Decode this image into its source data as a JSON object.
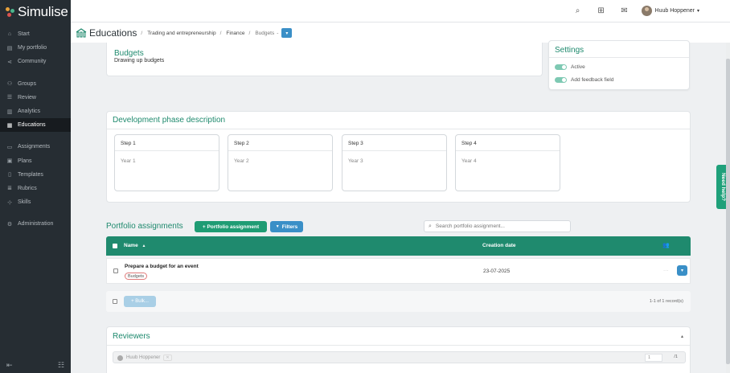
{
  "app": {
    "name": "Simulise"
  },
  "sidebar": {
    "items": [
      {
        "label": "Start",
        "icon": "home-icon",
        "glyph": "⌂"
      },
      {
        "label": "My portfolio",
        "icon": "briefcase-icon",
        "glyph": "▤"
      },
      {
        "label": "Community",
        "icon": "share-icon",
        "glyph": "⋖"
      },
      {
        "label": "Groups",
        "icon": "groups-icon",
        "glyph": "⚇"
      },
      {
        "label": "Review",
        "icon": "list-icon",
        "glyph": "☰"
      },
      {
        "label": "Analytics",
        "icon": "chart-icon",
        "glyph": "▥"
      },
      {
        "label": "Educations",
        "icon": "educations-icon",
        "glyph": "▦"
      },
      {
        "label": "Assignments",
        "icon": "book-icon",
        "glyph": "▭"
      },
      {
        "label": "Plans",
        "icon": "plans-icon",
        "glyph": "▣"
      },
      {
        "label": "Templates",
        "icon": "template-icon",
        "glyph": "▯"
      },
      {
        "label": "Rubrics",
        "icon": "rubrics-icon",
        "glyph": "≣"
      },
      {
        "label": "Skills",
        "icon": "skills-icon",
        "glyph": "⊹"
      },
      {
        "label": "Administration",
        "icon": "admin-icon",
        "glyph": "⚙"
      }
    ],
    "active": "Educations",
    "bottom_left_glyph": "⇤",
    "bottom_right_glyph": "☷"
  },
  "topbar": {
    "search_glyph": "⌕",
    "apps_glyph": "⊞",
    "inbox_glyph": "✉",
    "user_name": "Huub Hoppener",
    "user_caret": "▾"
  },
  "breadcrumb": {
    "title": "Educations",
    "items": [
      "Trading and entrepreneurship",
      "Finance",
      "Budgets"
    ],
    "sep": "/",
    "suffix": "-",
    "dropdown_glyph": "▾"
  },
  "header": {
    "title": "Budgets",
    "subtitle": "Drawing up budgets"
  },
  "settings": {
    "title": "Settings",
    "toggles": [
      {
        "label": "Active",
        "on": true
      },
      {
        "label": "Add feedback field",
        "on": true
      }
    ]
  },
  "development": {
    "title": "Development phase description",
    "steps": [
      {
        "label": "Step 1",
        "text": "Year 1"
      },
      {
        "label": "Step 2",
        "text": "Year 2"
      },
      {
        "label": "Step 3",
        "text": "Year 3"
      },
      {
        "label": "Step 4",
        "text": "Year 4"
      }
    ]
  },
  "portfolio": {
    "title": "Portfolio assignments",
    "add_button": "+ Portfolio assignment",
    "filters_button": "Filters",
    "filter_glyph": "▼",
    "search_placeholder": "Search portfolio assignment...",
    "columns": {
      "name": "Name",
      "sort_glyph": "▲",
      "creation_date": "Creation date",
      "people_glyph": "👥"
    },
    "rows": [
      {
        "name": "Prepare a budget for an event",
        "tag": "Budgets",
        "date": "23-07-2025",
        "dots": "···",
        "action_glyph": "▾"
      }
    ],
    "bulk_label": "+ Bulk...",
    "record_count": "1-1 of 1 record(s)"
  },
  "reviewers": {
    "title": "Reviewers",
    "caret": "▴",
    "selected": "Huub Hoppener",
    "remove_glyph": "✕",
    "page": "1",
    "total": "/1"
  },
  "need_help": "Need help?",
  "colors": {
    "sidebar": "#262d33",
    "accent_green": "#1f8a6e",
    "accent_blue": "#3a8fc7"
  }
}
